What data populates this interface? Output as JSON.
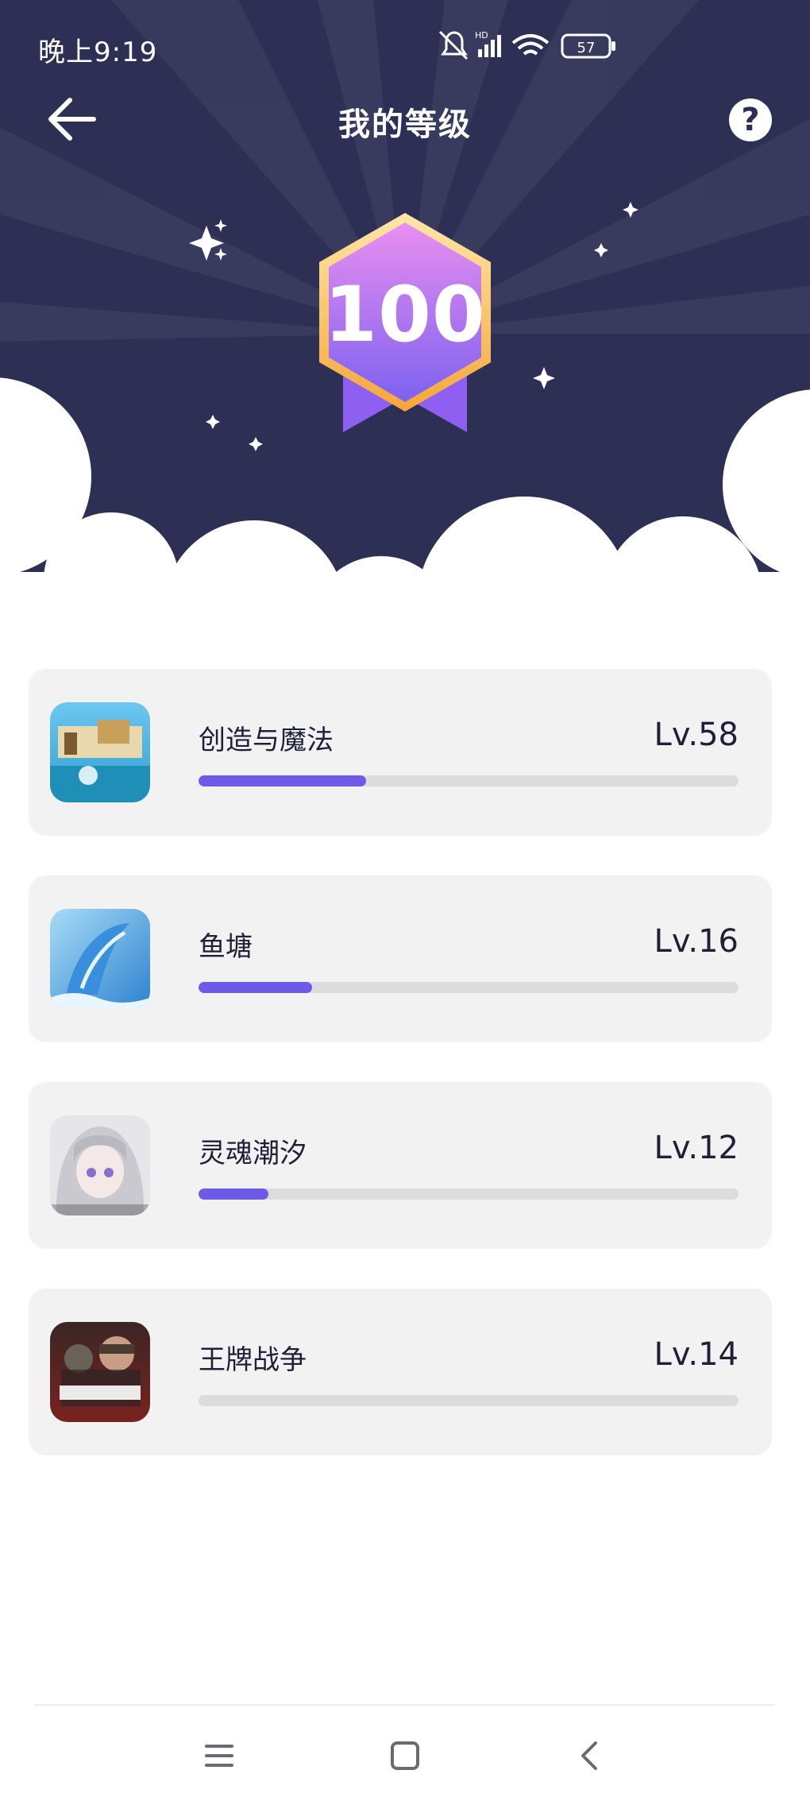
{
  "status_bar": {
    "time": "晚上9:19",
    "network_label": "HD",
    "battery": "57"
  },
  "header": {
    "title": "我的等级",
    "help_symbol": "?"
  },
  "badge": {
    "level": "100"
  },
  "games": [
    {
      "name": "创造与魔法",
      "level": "Lv.58",
      "progress": 0.31
    },
    {
      "name": "鱼塘",
      "level": "Lv.16",
      "progress": 0.21
    },
    {
      "name": "灵魂潮汐",
      "level": "Lv.12",
      "progress": 0.13
    },
    {
      "name": "王牌战争",
      "level": "Lv.14",
      "progress": 0.0
    }
  ],
  "icons": {
    "back": "arrow-left-icon",
    "help": "question-icon",
    "nav_menu": "menu-icon",
    "nav_home": "square-home-icon",
    "nav_back": "chevron-left-icon"
  },
  "colors": {
    "hero_bg": "#2d3054",
    "accent": "#6d5ae6",
    "card_bg": "#f2f2f3"
  }
}
